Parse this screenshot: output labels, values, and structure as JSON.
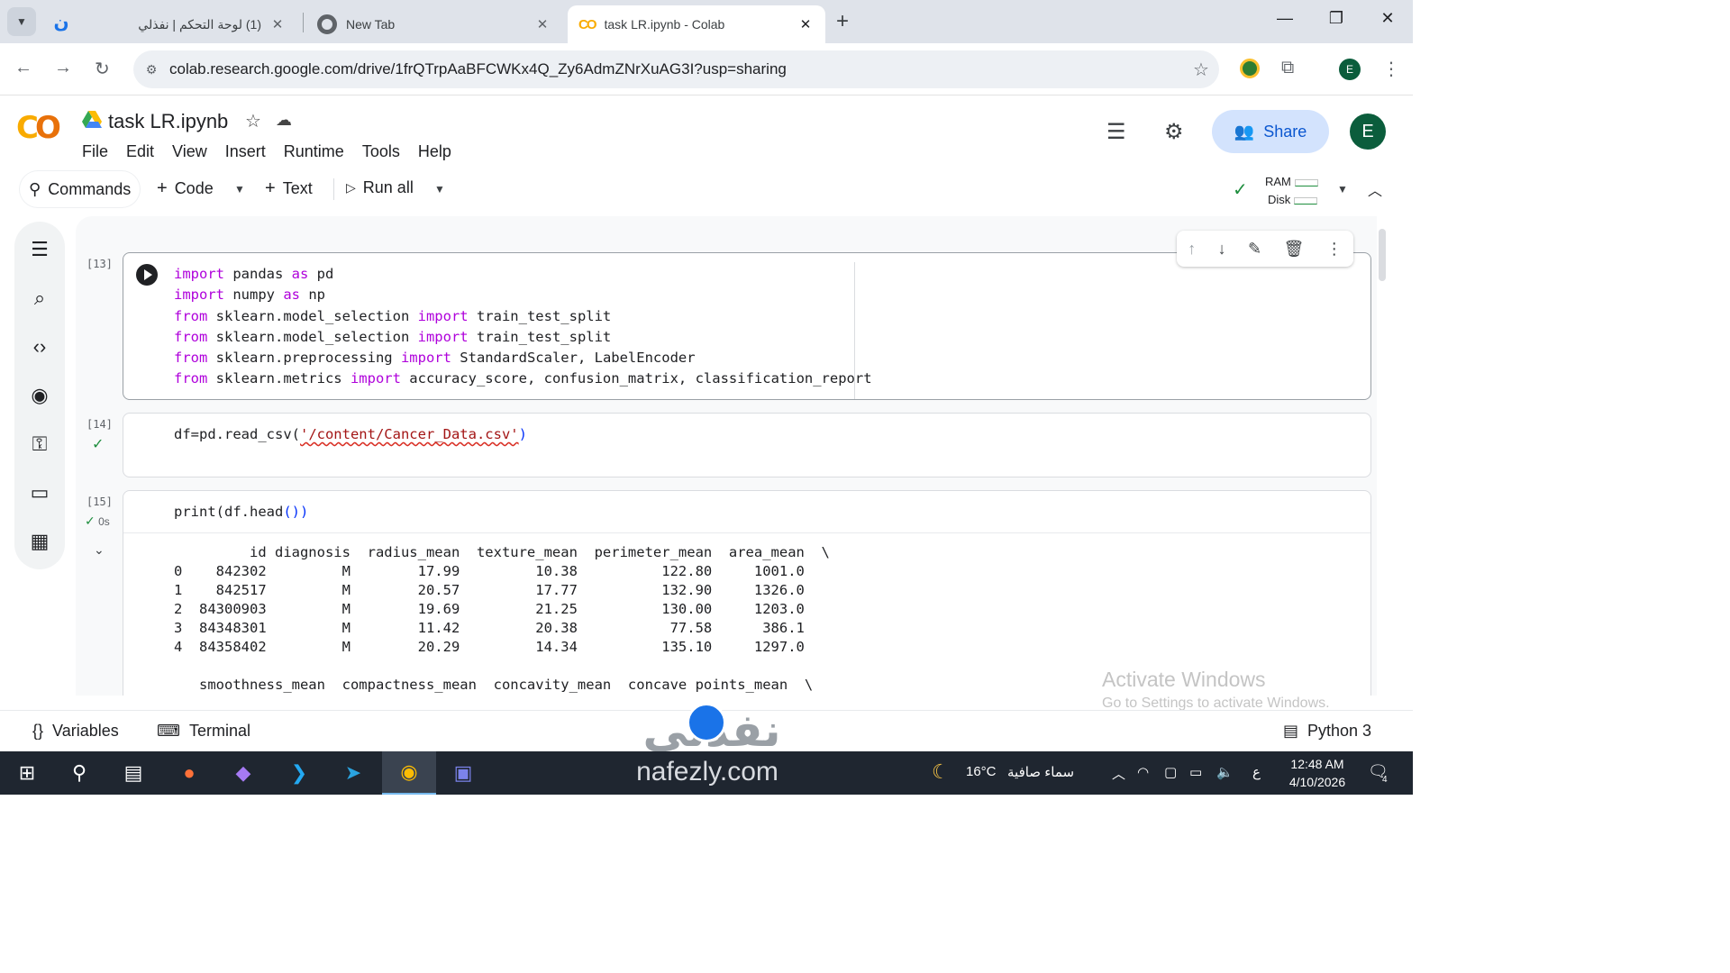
{
  "browser": {
    "tabs": [
      {
        "title": "(1) لوحة التحكم | نفذلي",
        "close": "✕"
      },
      {
        "title": "New Tab",
        "close": "✕"
      },
      {
        "title": "task LR.ipynb - Colab",
        "close": "✕"
      }
    ],
    "new_tab": "+",
    "url": "colab.research.google.com/drive/1frQTrpAaBFCWKx4Q_Zy6AdmZNrXuAG3I?usp=sharing",
    "profile_initial": "E"
  },
  "colab": {
    "notebook_title": "task LR.ipynb",
    "menu": [
      "File",
      "Edit",
      "View",
      "Insert",
      "Runtime",
      "Tools",
      "Help"
    ],
    "share_label": "Share",
    "avatar_initial": "E",
    "toolbar": {
      "commands": "Commands",
      "code": "Code",
      "text": "Text",
      "run_all": "Run all",
      "ram": "RAM",
      "disk": "Disk"
    },
    "cells": [
      {
        "count": "[13]",
        "lines": [
          "import pandas as pd",
          "import numpy as np",
          "from sklearn.model_selection import train_test_split",
          "from sklearn.model_selection import train_test_split",
          "from sklearn.preprocessing import StandardScaler, LabelEncoder",
          "from sklearn.metrics import accuracy_score, confusion_matrix, classification_report"
        ]
      },
      {
        "count": "[14]",
        "code_prefix": "df=pd.read_csv(",
        "code_string": "'/content/Cancer_Data.csv'",
        "code_suffix": ")"
      },
      {
        "count": "[15]",
        "time": "0s",
        "code_prefix": "print(df.head",
        "code_suffix": "())",
        "output": [
          "         id diagnosis  radius_mean  texture_mean  perimeter_mean  area_mean  \\",
          "0    842302         M        17.99         10.38          122.80     1001.0   ",
          "1    842517         M        20.57         17.77          132.90     1326.0   ",
          "2  84300903         M        19.69         21.25          130.00     1203.0   ",
          "3  84348301         M        11.42         20.38           77.58      386.1   ",
          "4  84358402         M        20.29         14.34          135.10     1297.0   ",
          "",
          "   smoothness_mean  compactness_mean  concavity_mean  concave points_mean  \\"
        ]
      }
    ],
    "status": {
      "variables": "Variables",
      "terminal": "Terminal",
      "runtime": "Python 3"
    }
  },
  "overlay": {
    "activate_title": "Activate Windows",
    "activate_sub": "Go to Settings to activate Windows.",
    "brand_arabic": "نفذلي",
    "brand_latin": "nafezly.com"
  },
  "taskbar": {
    "weather_temp": "16°C",
    "weather_text": "سماء صافية",
    "lang": "ع",
    "time": "12:48 AM",
    "date": "4/10/2026",
    "notifications": "4"
  },
  "colors": {
    "tabstrip": "#dfe3ea",
    "share_bg": "#d3e3fd",
    "share_fg": "#0b57d0",
    "keyword": "#af00db",
    "string": "#a31515",
    "success": "#1e8e3e",
    "taskbar": "#1f2630"
  }
}
